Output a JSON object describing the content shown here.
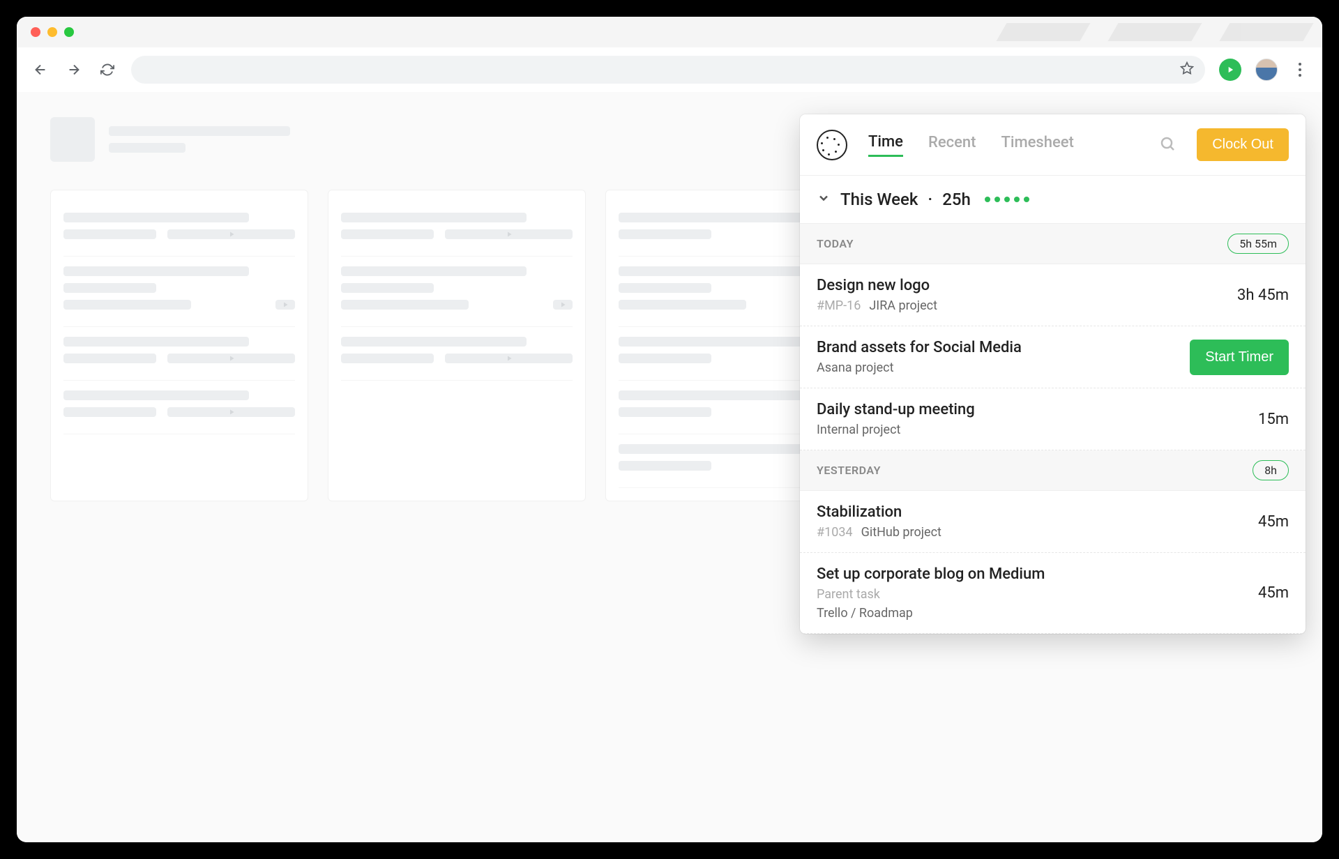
{
  "popup": {
    "tabs": {
      "time": "Time",
      "recent": "Recent",
      "timesheet": "Timesheet"
    },
    "clock_out": "Clock Out",
    "week": {
      "label": "This Week",
      "separator": "·",
      "hours": "25h"
    },
    "sections": [
      {
        "label": "TODAY",
        "pill": "5h 55m",
        "entries": [
          {
            "title": "Design new logo",
            "tag": "#MP-16",
            "project": "JIRA project",
            "time": "3h 45m"
          },
          {
            "title": "Brand assets for Social Media",
            "project": "Asana project",
            "action": "Start Timer"
          },
          {
            "title": "Daily stand-up meeting",
            "project": "Internal project",
            "time": "15m"
          }
        ]
      },
      {
        "label": "YESTERDAY",
        "pill": "8h",
        "entries": [
          {
            "title": "Stabilization",
            "tag": "#1034",
            "project": "GitHub project",
            "time": "45m"
          },
          {
            "title": "Set up corporate blog on Medium",
            "parent": "Parent task",
            "project": "Trello / Roadmap",
            "time": "45m"
          }
        ]
      }
    ]
  }
}
